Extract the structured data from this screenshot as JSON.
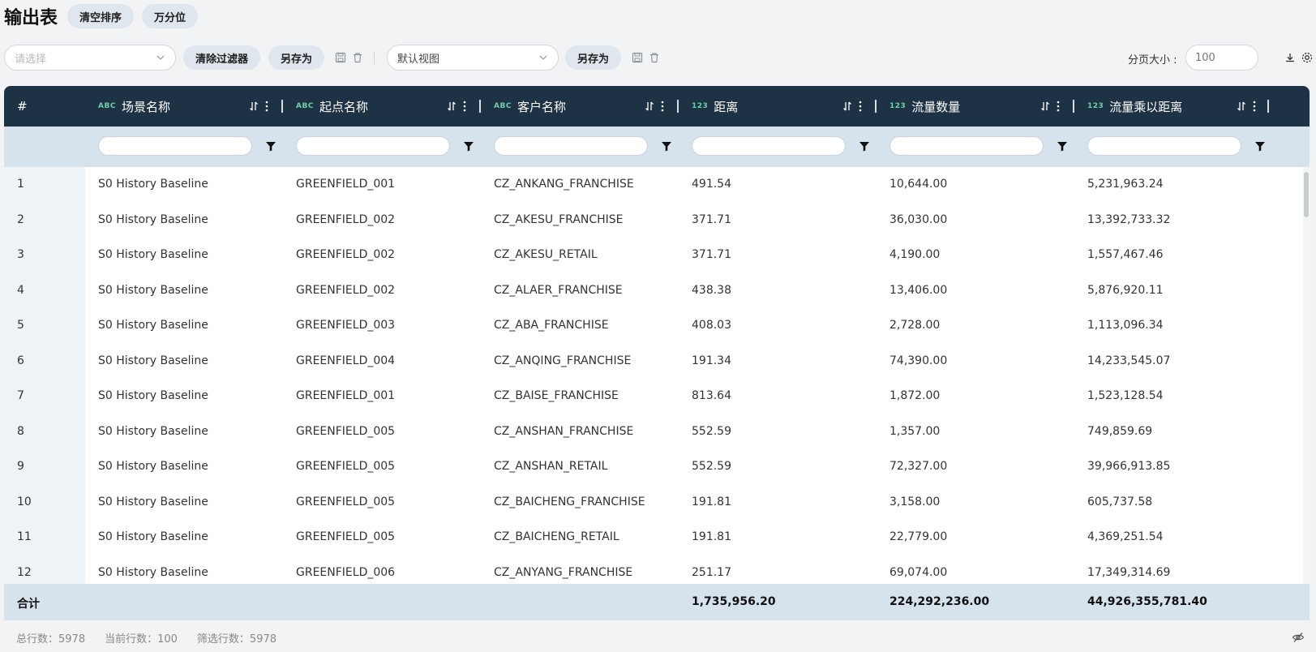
{
  "header": {
    "title": "输出表",
    "clear_sort": "清空排序",
    "per_ten_thousand": "万分位"
  },
  "toolbar": {
    "filter_select_placeholder": "请选择",
    "clear_filters": "清除过滤器",
    "save_as_1": "另存为",
    "view_select_value": "默认视图",
    "save_as_2": "另存为",
    "page_size_label": "分页大小 :",
    "page_size_value": "100"
  },
  "columns": [
    {
      "label": "#",
      "type": ""
    },
    {
      "label": "场景名称",
      "type": "ABC"
    },
    {
      "label": "起点名称",
      "type": "ABC"
    },
    {
      "label": "客户名称",
      "type": "ABC"
    },
    {
      "label": "距离",
      "type": "123"
    },
    {
      "label": "流量数量",
      "type": "123"
    },
    {
      "label": "流量乘以距离",
      "type": "123"
    }
  ],
  "rows": [
    [
      "1",
      "S0 History Baseline",
      "GREENFIELD_001",
      "CZ_ANKANG_FRANCHISE",
      "491.54",
      "10,644.00",
      "5,231,963.24"
    ],
    [
      "2",
      "S0 History Baseline",
      "GREENFIELD_002",
      "CZ_AKESU_FRANCHISE",
      "371.71",
      "36,030.00",
      "13,392,733.32"
    ],
    [
      "3",
      "S0 History Baseline",
      "GREENFIELD_002",
      "CZ_AKESU_RETAIL",
      "371.71",
      "4,190.00",
      "1,557,467.46"
    ],
    [
      "4",
      "S0 History Baseline",
      "GREENFIELD_002",
      "CZ_ALAER_FRANCHISE",
      "438.38",
      "13,406.00",
      "5,876,920.11"
    ],
    [
      "5",
      "S0 History Baseline",
      "GREENFIELD_003",
      "CZ_ABA_FRANCHISE",
      "408.03",
      "2,728.00",
      "1,113,096.34"
    ],
    [
      "6",
      "S0 History Baseline",
      "GREENFIELD_004",
      "CZ_ANQING_FRANCHISE",
      "191.34",
      "74,390.00",
      "14,233,545.07"
    ],
    [
      "7",
      "S0 History Baseline",
      "GREENFIELD_001",
      "CZ_BAISE_FRANCHISE",
      "813.64",
      "1,872.00",
      "1,523,128.54"
    ],
    [
      "8",
      "S0 History Baseline",
      "GREENFIELD_005",
      "CZ_ANSHAN_FRANCHISE",
      "552.59",
      "1,357.00",
      "749,859.69"
    ],
    [
      "9",
      "S0 History Baseline",
      "GREENFIELD_005",
      "CZ_ANSHAN_RETAIL",
      "552.59",
      "72,327.00",
      "39,966,913.85"
    ],
    [
      "10",
      "S0 History Baseline",
      "GREENFIELD_005",
      "CZ_BAICHENG_FRANCHISE",
      "191.81",
      "3,158.00",
      "605,737.58"
    ],
    [
      "11",
      "S0 History Baseline",
      "GREENFIELD_005",
      "CZ_BAICHENG_RETAIL",
      "191.81",
      "22,779.00",
      "4,369,251.54"
    ],
    [
      "12",
      "S0 History Baseline",
      "GREENFIELD_006",
      "CZ_ANYANG_FRANCHISE",
      "251.17",
      "69,074.00",
      "17,349,314.69"
    ]
  ],
  "totals": {
    "label": "合计",
    "distance": "1,735,956.20",
    "flow_qty": "224,292,236.00",
    "flow_x_distance": "44,926,355,781.40"
  },
  "status": {
    "total_rows": "总行数：5978",
    "current_rows": "当前行数：100",
    "filtered_rows": "筛选行数：5978"
  },
  "icons": [
    "chevron-down-icon",
    "save-icon",
    "trash-icon",
    "download-icon",
    "settings-icon",
    "sort-icon",
    "more-vertical-icon",
    "filter-icon",
    "eye-off-icon"
  ],
  "colors": {
    "header_bg": "#1e3245",
    "filter_row_bg": "#d6e2ec",
    "type_badge": "#6fd0a8",
    "pill_bg": "#dfe6ee"
  }
}
